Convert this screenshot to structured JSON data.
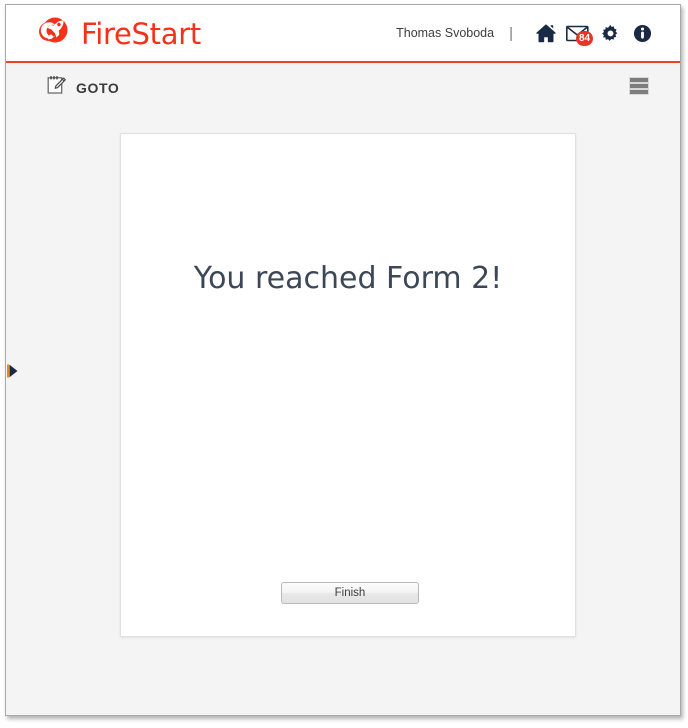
{
  "window": {
    "frame_border_color": "#a9a9a9",
    "page_background": "#f4f4f4"
  },
  "header": {
    "brand_name": "FireStart",
    "brand_color": "#f4321a",
    "accent_border_color": "#f04124",
    "logo_icon": "rocket-logo-icon",
    "user_name": "Thomas Svoboda",
    "divider": "|",
    "icons": [
      {
        "name": "home-icon",
        "label": "Home"
      },
      {
        "name": "mail-icon",
        "label": "Messages",
        "badge": "84",
        "badge_color": "#e8342a"
      },
      {
        "name": "gear-icon",
        "label": "Settings"
      },
      {
        "name": "info-icon",
        "label": "Information"
      }
    ]
  },
  "toolbar": {
    "goto_label": "GOTO",
    "goto_icon": "form-edit-icon",
    "menu_icon": "hamburger-menu-icon"
  },
  "sidebar": {
    "handle_icon": "expand-right-arrow-icon"
  },
  "main": {
    "form_message": "You reached Form 2!",
    "finish_label": "Finish"
  }
}
